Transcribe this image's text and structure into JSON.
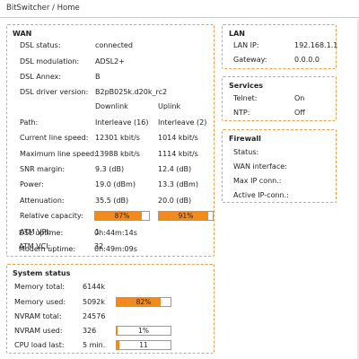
{
  "breadcrumb": "BitSwitcher / Home",
  "colors": {
    "accent": "#f28a1e",
    "box_border": "#f2a04a"
  },
  "wan": {
    "title": "WAN",
    "rows_top": [
      {
        "label": "DSL status:",
        "value": "connected"
      },
      {
        "label": "DSL modulation:",
        "value": "ADSL2+"
      },
      {
        "label": "DSL Annex:",
        "value": "B"
      },
      {
        "label": "DSL driver version:",
        "value": "B2pB025k.d20k_rc2"
      }
    ],
    "col_headers": [
      "Downlink",
      "Uplink"
    ],
    "rows_dual": [
      {
        "label": "Path:",
        "down": "Interleave (16)",
        "up": "Interleave (2)"
      },
      {
        "label": "Current line speed:",
        "down": "12301 kbit/s",
        "up": "1014 kbit/s"
      },
      {
        "label": "Maximum line speed:",
        "down": "13988 kbit/s",
        "up": "1114 kbit/s"
      },
      {
        "label": "SNR margin:",
        "down": "9.3 (dB)",
        "up": "12.4 (dB)"
      },
      {
        "label": "Power:",
        "down": "19.0 (dBm)",
        "up": "13.3 (dBm)"
      },
      {
        "label": "Attenuation:",
        "down": "35.5 (dB)",
        "up": "20.0 (dB)"
      }
    ],
    "relative_capacity": {
      "label": "Relative capacity:",
      "down": {
        "text": "87%",
        "fraction": 0.87
      },
      "up": {
        "text": "91%",
        "fraction": 0.91
      }
    },
    "rows_bottom": [
      {
        "label": "ATM VPI:",
        "value": "1"
      },
      {
        "label": "ATM VCI:",
        "value": "32"
      },
      {
        "label": "DSL uptime:",
        "value": "0h:44m:14s"
      },
      {
        "label": "Modem uptime:",
        "value": "0h:49m:09s"
      }
    ]
  },
  "lan": {
    "title": "LAN",
    "rows": [
      {
        "label": "LAN IP:",
        "value": "192.168.1.1"
      },
      {
        "label": "Gateway:",
        "value": "0.0.0.0"
      }
    ]
  },
  "services": {
    "title": "Services",
    "rows": [
      {
        "label": "Telnet:",
        "value": "On"
      },
      {
        "label": "NTP:",
        "value": "Off"
      }
    ]
  },
  "firewall": {
    "title": "Firewall",
    "rows": [
      {
        "label": "Status:",
        "value": ""
      },
      {
        "label": "WAN interface:",
        "value": ""
      },
      {
        "label": "Max IP conn.:",
        "value": ""
      },
      {
        "label": "Active IP-conn.:",
        "value": ""
      }
    ]
  },
  "system": {
    "title": "System status",
    "memory_total": {
      "label": "Memory total:",
      "value": "6144k"
    },
    "memory_used": {
      "label": "Memory used:",
      "value": "5092k",
      "bar_text": "82%",
      "fraction": 0.82
    },
    "nvram_total": {
      "label": "NVRAM total:",
      "value": "24576"
    },
    "nvram_used": {
      "label": "NVRAM used:",
      "value": "326",
      "bar_text": "1%",
      "fraction": 0.01
    },
    "cpu_load": {
      "label": "CPU load last:",
      "value": "5 min.",
      "bar_text": "11",
      "fraction": 0.05
    }
  }
}
